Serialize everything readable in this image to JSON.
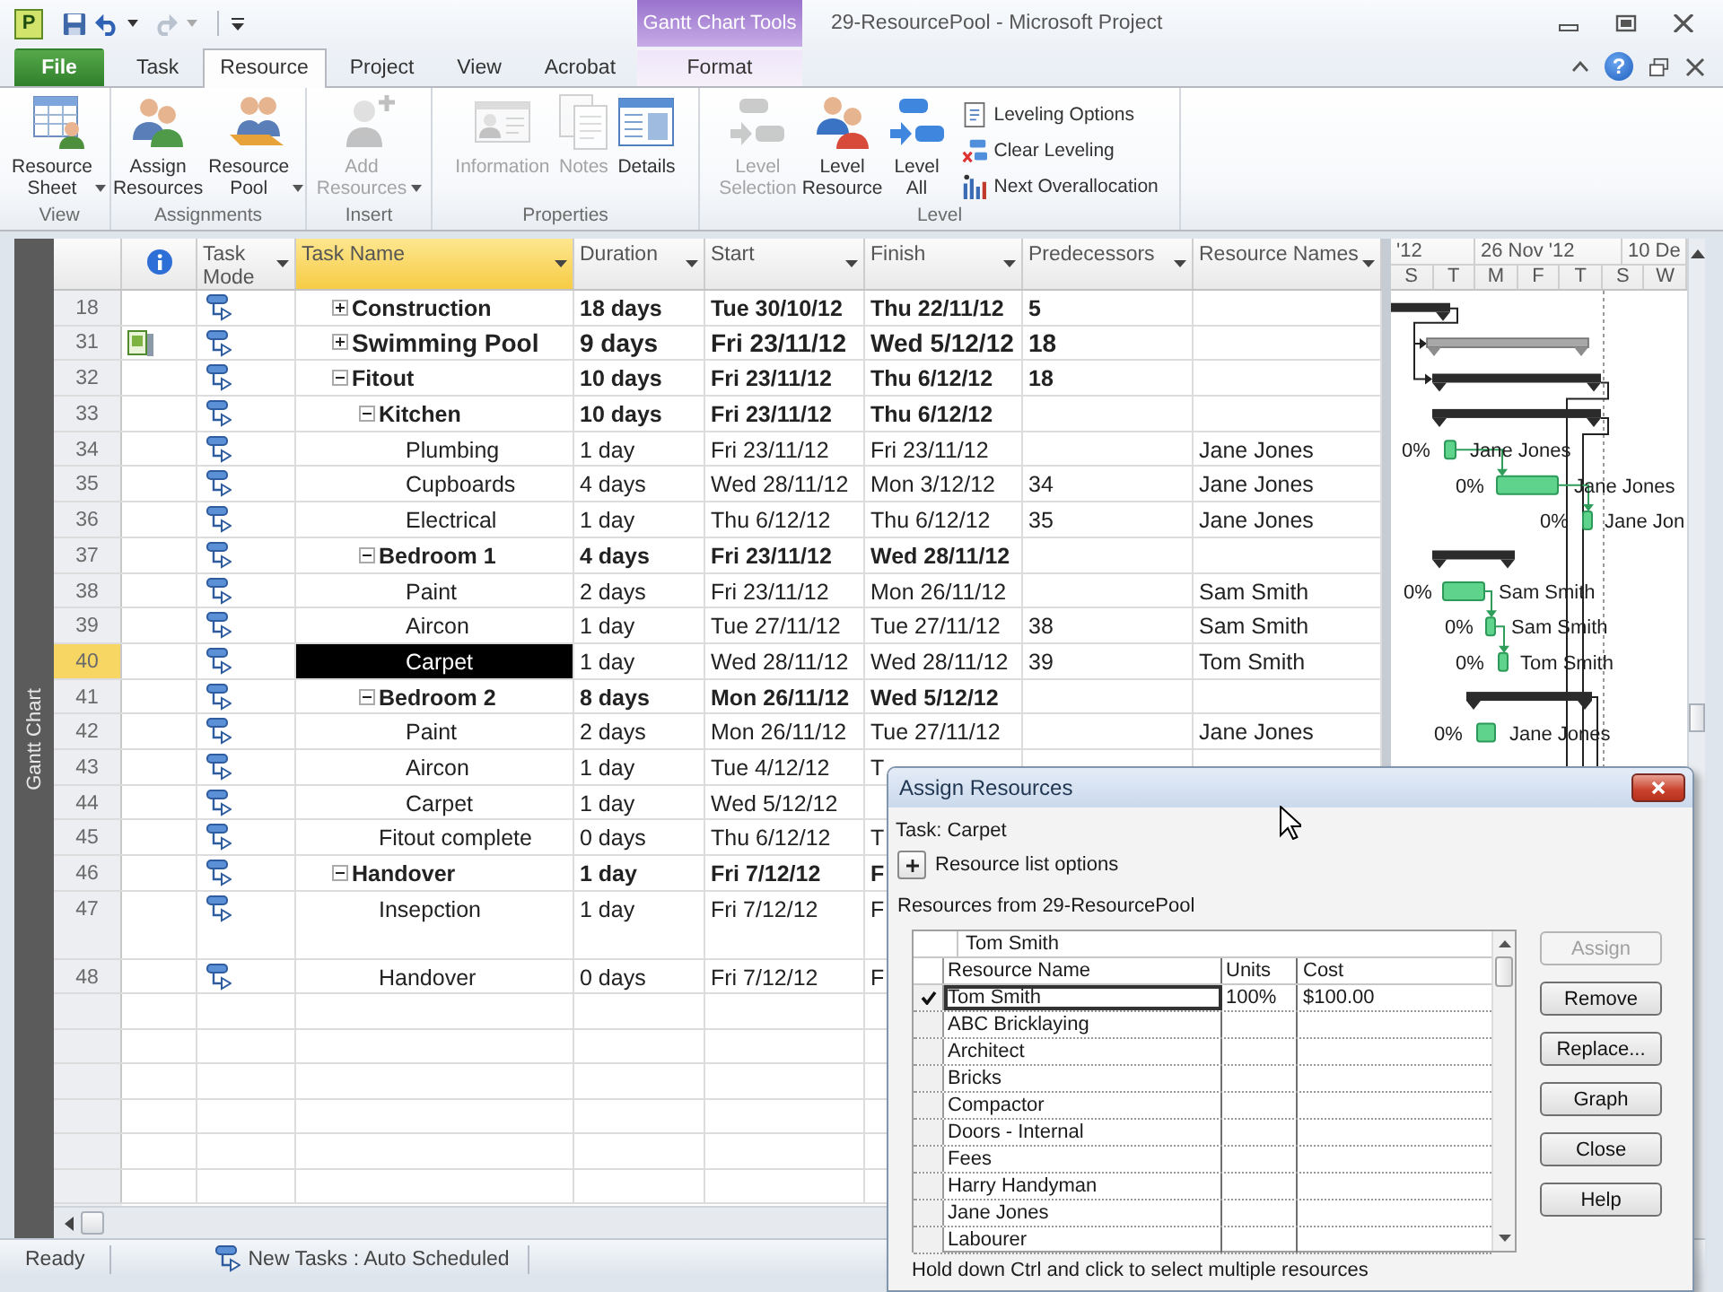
{
  "title_bar": {
    "app_letter": "P",
    "contextual_tab": "Gantt Chart Tools",
    "title": "29-ResourcePool - Microsoft Project"
  },
  "tabs": [
    {
      "label": "File",
      "kind": "file",
      "selected": false
    },
    {
      "label": "Task",
      "kind": "tab",
      "selected": false
    },
    {
      "label": "Resource",
      "kind": "tab",
      "selected": true
    },
    {
      "label": "Project",
      "kind": "tab",
      "selected": false
    },
    {
      "label": "View",
      "kind": "tab",
      "selected": false
    },
    {
      "label": "Acrobat",
      "kind": "tab",
      "selected": false
    },
    {
      "label": "Format",
      "kind": "contextual",
      "selected": false
    }
  ],
  "help": "?",
  "ribbon": {
    "groups": [
      {
        "label": "View",
        "buttons": [
          {
            "label": "Resource Sheet",
            "kind": "large",
            "dropdown": true,
            "disabled": false
          }
        ]
      },
      {
        "label": "Assignments",
        "buttons": [
          {
            "label": "Assign Resources",
            "kind": "large",
            "dropdown": false,
            "disabled": false
          },
          {
            "label": "Resource Pool",
            "kind": "large",
            "dropdown": true,
            "disabled": false
          }
        ]
      },
      {
        "label": "Insert",
        "buttons": [
          {
            "label": "Add Resources",
            "kind": "large",
            "dropdown": true,
            "disabled": true
          }
        ]
      },
      {
        "label": "Properties",
        "buttons": [
          {
            "label": "Information",
            "kind": "large",
            "dropdown": false,
            "disabled": true
          },
          {
            "label": "Notes",
            "kind": "large",
            "dropdown": false,
            "disabled": true
          },
          {
            "label": "Details",
            "kind": "large",
            "dropdown": false,
            "disabled": false
          }
        ]
      },
      {
        "label": "Level",
        "buttons": [
          {
            "label": "Level Selection",
            "kind": "large",
            "dropdown": false,
            "disabled": true
          },
          {
            "label": "Level Resource",
            "kind": "large",
            "dropdown": false,
            "disabled": false
          },
          {
            "label": "Level All",
            "kind": "large",
            "dropdown": false,
            "disabled": false
          },
          {
            "label": "Leveling Options",
            "kind": "small",
            "dropdown": false,
            "disabled": false
          },
          {
            "label": "Clear Leveling",
            "kind": "small",
            "dropdown": false,
            "disabled": false
          },
          {
            "label": "Next Overallocation",
            "kind": "small",
            "dropdown": false,
            "disabled": false
          }
        ]
      }
    ]
  },
  "view_bar": {
    "label": "Gantt Chart"
  },
  "table": {
    "columns": [
      {
        "label": "Task Mode",
        "selected": false
      },
      {
        "label": "Task Name",
        "selected": true
      },
      {
        "label": "Duration",
        "selected": false
      },
      {
        "label": "Start",
        "selected": false
      },
      {
        "label": "Finish",
        "selected": false
      },
      {
        "label": "Predecessors",
        "selected": false
      },
      {
        "label": "Resource Names",
        "selected": false
      }
    ],
    "tasks": [
      {
        "id": "18",
        "name": "Construction",
        "kind": "summary",
        "expanded": false,
        "selected": false,
        "duration": "18 days",
        "start": "Tue 30/10/12",
        "finish": "Thu 22/11/12",
        "predecessors": "5"
      },
      {
        "id": "31",
        "name": "Swimming Pool",
        "kind": "project",
        "expanded": false,
        "selected": false,
        "indicator": {
          "kind": "project"
        },
        "duration": "9 days",
        "start": "Fri 23/11/12",
        "finish": "Wed 5/12/12",
        "predecessors": "18"
      },
      {
        "id": "32",
        "name": "Fitout",
        "kind": "summary",
        "expanded": true,
        "selected": false,
        "duration": "10 days",
        "start": "Fri 23/11/12",
        "finish": "Thu 6/12/12",
        "predecessors": "18",
        "children": [
          {
            "id": "33",
            "name": "Kitchen",
            "kind": "summary",
            "expanded": true,
            "selected": false,
            "duration": "10 days",
            "start": "Fri 23/11/12",
            "finish": "Thu 6/12/12",
            "children": [
              {
                "id": "34",
                "name": "Plumbing",
                "kind": "task",
                "selected": false,
                "duration": "1 day",
                "start": "Fri 23/11/12",
                "finish": "Fri 23/11/12",
                "resources": "Jane Jones"
              },
              {
                "id": "35",
                "name": "Cupboards",
                "kind": "task",
                "selected": false,
                "duration": "4 days",
                "start": "Wed 28/11/12",
                "finish": "Mon 3/12/12",
                "predecessors": "34",
                "resources": "Jane Jones"
              },
              {
                "id": "36",
                "name": "Electrical",
                "kind": "task",
                "selected": false,
                "duration": "1 day",
                "start": "Thu 6/12/12",
                "finish": "Thu 6/12/12",
                "predecessors": "35",
                "resources": "Jane Jones"
              }
            ]
          },
          {
            "id": "37",
            "name": "Bedroom 1",
            "kind": "summary",
            "expanded": true,
            "selected": false,
            "duration": "4 days",
            "start": "Fri 23/11/12",
            "finish": "Wed 28/11/12",
            "children": [
              {
                "id": "38",
                "name": "Paint",
                "kind": "task",
                "selected": false,
                "duration": "2 days",
                "start": "Fri 23/11/12",
                "finish": "Mon 26/11/12",
                "resources": "Sam Smith"
              },
              {
                "id": "39",
                "name": "Aircon",
                "kind": "task",
                "selected": false,
                "duration": "1 day",
                "start": "Tue 27/11/12",
                "finish": "Tue 27/11/12",
                "predecessors": "38",
                "resources": "Sam Smith"
              },
              {
                "id": "40",
                "name": "Carpet",
                "kind": "task",
                "selected": true,
                "duration": "1 day",
                "start": "Wed 28/11/12",
                "finish": "Wed 28/11/12",
                "predecessors": "39",
                "resources": "Tom Smith"
              }
            ]
          },
          {
            "id": "41",
            "name": "Bedroom 2",
            "kind": "summary",
            "expanded": true,
            "selected": false,
            "duration": "8 days",
            "start": "Mon 26/11/12",
            "finish": "Wed 5/12/12",
            "children": [
              {
                "id": "42",
                "name": "Paint",
                "kind": "task",
                "selected": false,
                "duration": "2 days",
                "start": "Mon 26/11/12",
                "finish": "Tue 27/11/12",
                "resources": "Jane Jones"
              },
              {
                "id": "43",
                "name": "Aircon",
                "kind": "task",
                "selected": false,
                "duration": "1 day",
                "start": "Tue 4/12/12",
                "finish": "T"
              },
              {
                "id": "44",
                "name": "Carpet",
                "kind": "task",
                "selected": false,
                "duration": "1 day",
                "start": "Wed 5/12/12"
              }
            ]
          },
          {
            "id": "45",
            "name": "Fitout complete",
            "kind": "task",
            "selected": false,
            "duration": "0 days",
            "start": "Thu 6/12/12",
            "finish": "T"
          }
        ]
      },
      {
        "id": "46",
        "name": "Handover",
        "kind": "summary",
        "expanded": true,
        "selected": false,
        "duration": "1 day",
        "start": "Fri 7/12/12",
        "finish": "F",
        "children": [
          {
            "id": "47",
            "name": "Insepction",
            "kind": "task",
            "selected": false,
            "duration": "1 day",
            "start": "Fri 7/12/12",
            "finish": "F"
          },
          {
            "id": "48",
            "name": "Handover",
            "kind": "task",
            "selected": false,
            "duration": "0 days",
            "start": "Fri 7/12/12",
            "finish": "F"
          }
        ]
      }
    ]
  },
  "gantt": {
    "timescale_top": [
      "'12",
      "26 Nov '12",
      "10 De"
    ],
    "timescale_bottom": [
      "S",
      "T",
      "M",
      "F",
      "T",
      "S",
      "W"
    ],
    "bars": [
      {
        "kind": "summary"
      },
      {
        "kind": "project"
      },
      {
        "kind": "summary"
      },
      {
        "kind": "summary"
      },
      {
        "kind": "task",
        "percent": "0%",
        "label": "Jane Jones"
      },
      {
        "kind": "task",
        "percent": "0%",
        "label": "Jane Jones"
      },
      {
        "kind": "task",
        "percent": "0%",
        "label": "Jane Jon"
      },
      {
        "kind": "summary"
      },
      {
        "kind": "task",
        "percent": "0%",
        "label": "Sam Smith"
      },
      {
        "kind": "task",
        "percent": "0%",
        "label": "Sam Smith"
      },
      {
        "kind": "task",
        "percent": "0%",
        "label": "Tom Smith"
      },
      {
        "kind": "summary"
      },
      {
        "kind": "task",
        "percent": "0%",
        "label": "Jane Jones"
      }
    ]
  },
  "status_bar": {
    "mode": "Ready",
    "new_tasks": "New Tasks : Auto Scheduled"
  },
  "assign_dialog": {
    "title": "Assign Resources",
    "task_label": "Task: Carpet",
    "options_expanded": false,
    "options_label": "Resource list options",
    "pool_label": "Resources from 29-ResourcePool",
    "edit_value": "Tom Smith",
    "columns": [
      "Resource Name",
      "Units",
      "Cost"
    ],
    "rows": [
      {
        "name": "Tom Smith",
        "units": "100%",
        "cost": "$100.00",
        "assigned": true,
        "selected": true
      },
      {
        "name": "ABC Bricklaying",
        "assigned": false,
        "selected": false
      },
      {
        "name": "Architect",
        "assigned": false,
        "selected": false
      },
      {
        "name": "Bricks",
        "assigned": false,
        "selected": false
      },
      {
        "name": "Compactor",
        "assigned": false,
        "selected": false
      },
      {
        "name": "Doors - Internal",
        "assigned": false,
        "selected": false
      },
      {
        "name": "Fees",
        "assigned": false,
        "selected": false
      },
      {
        "name": "Harry Handyman",
        "assigned": false,
        "selected": false
      },
      {
        "name": "Jane Jones",
        "assigned": false,
        "selected": false
      },
      {
        "name": "Labourer",
        "assigned": false,
        "selected": false
      }
    ],
    "buttons": [
      {
        "label": "Assign",
        "disabled": true
      },
      {
        "label": "Remove",
        "disabled": false
      },
      {
        "label": "Replace...",
        "disabled": false
      },
      {
        "label": "Graph",
        "disabled": false
      },
      {
        "label": "Close",
        "disabled": false
      },
      {
        "label": "Help",
        "disabled": false
      }
    ],
    "hint": "Hold down Ctrl and click to select multiple resources"
  }
}
